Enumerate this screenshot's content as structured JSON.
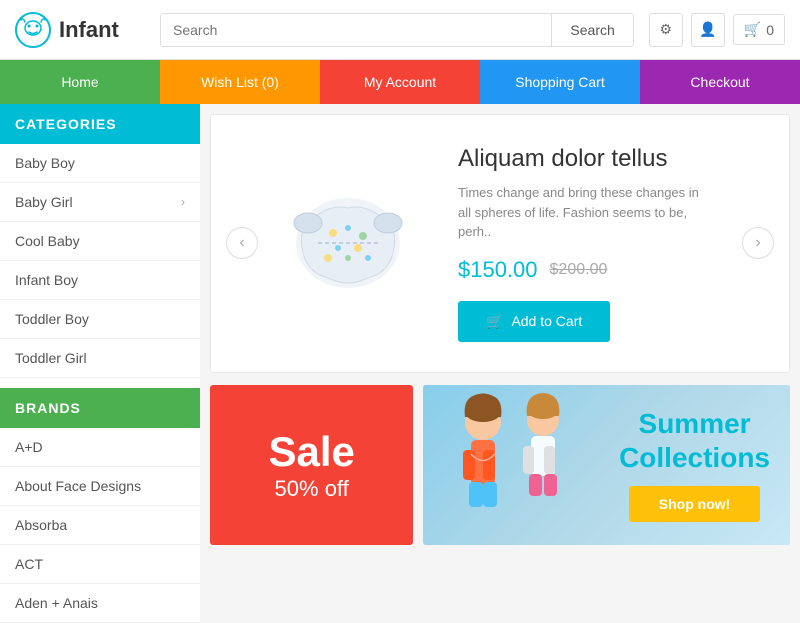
{
  "header": {
    "logo_text": "Infant",
    "search_placeholder": "Search",
    "search_button_label": "Search",
    "icons": {
      "gear": "⚙",
      "user": "👤",
      "cart": "🛒",
      "cart_count": "0"
    }
  },
  "nav": {
    "items": [
      {
        "label": "Home",
        "color": "#4caf50"
      },
      {
        "label": "Wish List (0)",
        "color": "#ff9800"
      },
      {
        "label": "My Account",
        "color": "#f44336"
      },
      {
        "label": "Shopping Cart",
        "color": "#2196f3"
      },
      {
        "label": "Checkout",
        "color": "#9c27b0"
      }
    ]
  },
  "sidebar": {
    "categories_title": "CATEGORIES",
    "brands_title": "BRANDS",
    "categories": [
      {
        "label": "Baby Boy",
        "has_arrow": false
      },
      {
        "label": "Baby Girl",
        "has_arrow": true
      },
      {
        "label": "Cool Baby",
        "has_arrow": false
      },
      {
        "label": "Infant Boy",
        "has_arrow": false
      },
      {
        "label": "Toddler Boy",
        "has_arrow": false
      },
      {
        "label": "Toddler Girl",
        "has_arrow": false
      }
    ],
    "brands": [
      {
        "label": "A+D"
      },
      {
        "label": "About Face Designs"
      },
      {
        "label": "Absorba"
      },
      {
        "label": "ACT"
      },
      {
        "label": "Aden + Anais"
      }
    ]
  },
  "featured_product": {
    "title": "Aliquam dolor tellus",
    "description": "Times change and bring these changes in all spheres of life. Fashion seems to be, perh..",
    "price_current": "$150.00",
    "price_old": "$200.00",
    "add_to_cart_label": "Add to Cart"
  },
  "banners": {
    "sale_text": "Sale",
    "sale_subtext": "50% off",
    "summer_title": "Summer",
    "summer_subtitle": "Collections",
    "shop_now_label": "Shop now!"
  }
}
